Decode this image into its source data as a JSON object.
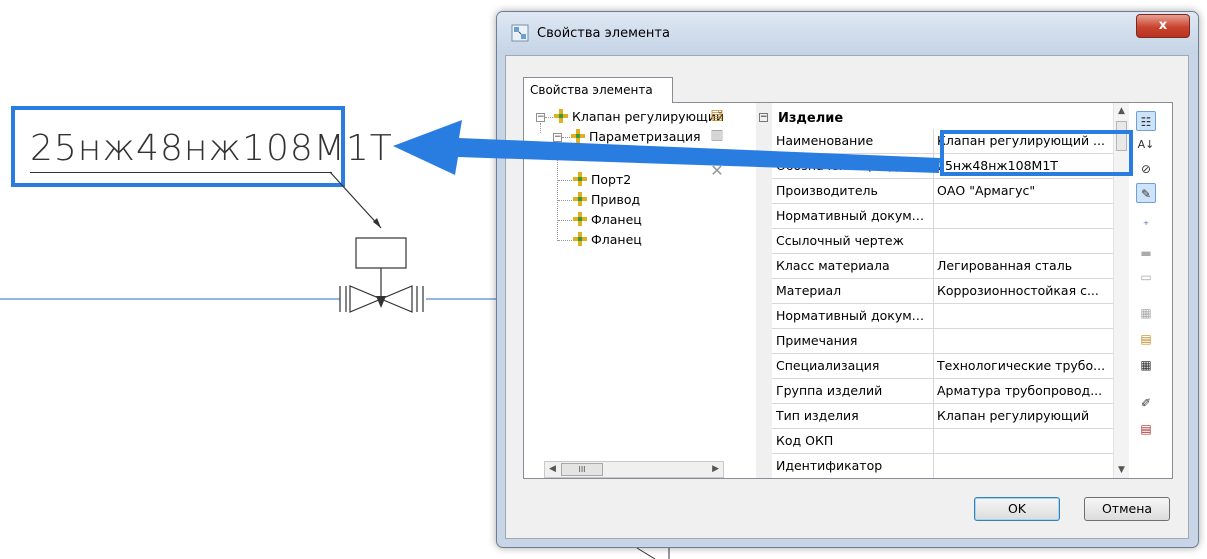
{
  "drawing": {
    "label_text": "25нж48нж108М1Т"
  },
  "window": {
    "title": "Свойства элемента",
    "close_glyph": "x"
  },
  "tab": {
    "label": "Свойства элемента"
  },
  "tree": {
    "nodes": [
      {
        "label": "Клапан регулирующий"
      },
      {
        "label": "Параметризация"
      },
      {
        "label": "Порт2"
      },
      {
        "label": "Привод"
      },
      {
        "label": "Фланец"
      },
      {
        "label": "Фланец"
      }
    ],
    "scroll_grip": "III"
  },
  "grid": {
    "category": "Изделие",
    "rows": [
      {
        "name": "Наименование",
        "value": "Клапан регулирующий ..."
      },
      {
        "name": "Обозначение (модель)",
        "value": "25нж48нж108М1Т"
      },
      {
        "name": "Производитель",
        "value": "ОАО \"Армагус\""
      },
      {
        "name": "Нормативный документ",
        "value": ""
      },
      {
        "name": "Ссылочный чертеж",
        "value": ""
      },
      {
        "name": "Класс материала",
        "value": "Легированная сталь"
      },
      {
        "name": "Материал",
        "value": "Коррозионностойкая с..."
      },
      {
        "name": "Нормативный докумен...",
        "value": ""
      },
      {
        "name": "Примечания",
        "value": ""
      },
      {
        "name": "Специализация",
        "value": "Технологические трубо..."
      },
      {
        "name": "Группа изделий",
        "value": "Арматура трубопровод..."
      },
      {
        "name": "Тип изделия",
        "value": "Клапан регулирующий"
      },
      {
        "name": "Код ОКП",
        "value": ""
      },
      {
        "name": "Идентификатор",
        "value": ""
      }
    ]
  },
  "buttons": {
    "ok": "OK",
    "cancel": "Отмена"
  },
  "colors": {
    "highlight": "#2a7de0",
    "arrow": "#2a7de0"
  }
}
